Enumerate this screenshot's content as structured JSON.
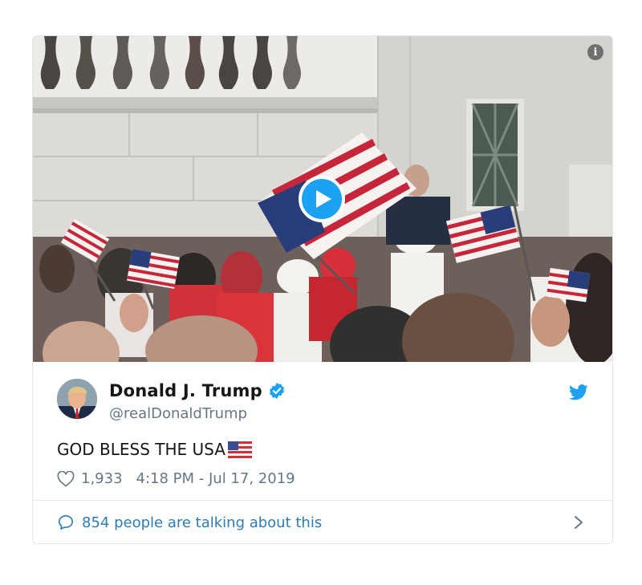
{
  "media": {
    "info_label": "i",
    "play_label": "Play video"
  },
  "tweet": {
    "display_name": "Donald J. Trump",
    "handle": "@realDonaldTrump",
    "text": "GOD BLESS THE USA",
    "text_emoji": "us-flag-emoji",
    "like_count": "1,933",
    "timestamp": "4:18 PM - Jul 17, 2019"
  },
  "footer": {
    "talking": "854 people are talking about this"
  },
  "icons": {
    "info": "info-icon",
    "play": "play-icon",
    "verified": "verified-badge-icon",
    "brand": "twitter-bird-icon",
    "like": "heart-icon",
    "reply": "speech-bubble-icon",
    "chevron": "chevron-right-icon"
  },
  "colors": {
    "twitter_blue": "#1da1f2",
    "link_blue": "#2b7bb9",
    "muted": "#657786",
    "text": "#14171a",
    "border": "#e1e8ed"
  }
}
